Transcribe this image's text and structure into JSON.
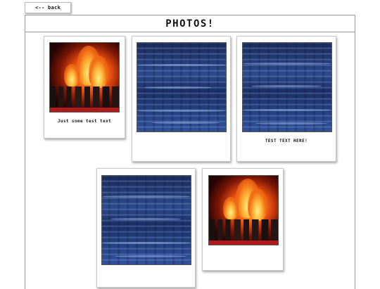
{
  "nav": {
    "back_label": "<-- back"
  },
  "header": {
    "title": "PHOTOS!"
  },
  "photos": [
    {
      "image": "burning-city",
      "caption": "Just some test text"
    },
    {
      "image": "water",
      "caption": ""
    },
    {
      "image": "water",
      "caption": "TEST TEXT HERE!"
    },
    {
      "image": "water",
      "caption": ""
    },
    {
      "image": "burning-city",
      "caption": ""
    }
  ]
}
